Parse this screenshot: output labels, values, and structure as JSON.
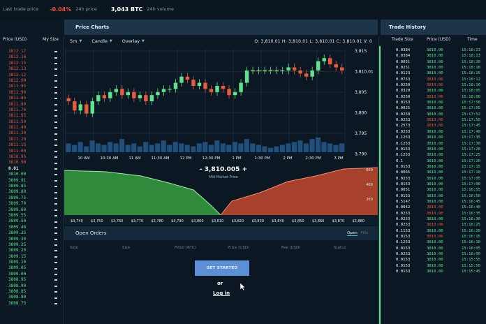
{
  "topbar": {
    "last_trade_label": "Last trade price",
    "last_trade_change": "-0.04%",
    "change_label": "24h price",
    "volume_value": "3,043 BTC",
    "volume_label": "24h volume"
  },
  "order_book": {
    "col_price": "Price (USD)",
    "col_size": "My Size",
    "asks": [
      "3812.17",
      "3812.16",
      "3812.15",
      "3812.13",
      "3812.12",
      "3812.00",
      "3811.95",
      "3811.90",
      "3811.85",
      "3811.80",
      "3811.74",
      "3811.65",
      "3811.50",
      "3811.40",
      "3811.30",
      "3811.20",
      "3811.15",
      "3811.00",
      "3810.95",
      "3810.90"
    ],
    "mid": "0.01",
    "bids": [
      "3810.00",
      "3809.91",
      "3809.85",
      "3809.80",
      "3809.75",
      "3809.70",
      "3809.60",
      "3809.55",
      "3809.50",
      "3809.40",
      "3809.35",
      "3809.30",
      "3809.25",
      "3809.20",
      "3809.15",
      "3809.10",
      "3809.05",
      "3809.00",
      "3808.95",
      "3808.90",
      "3808.85",
      "3808.80",
      "3808.75"
    ]
  },
  "price_chart": {
    "title": "Price Charts",
    "interval": "5m",
    "chart_type": "Candle",
    "overlay": "Overlay",
    "ohlc": "O: 3,810.01   H: 3,810.01   L: 3,810.01   C: 3,810.01   V: 0",
    "y_ticks": [
      "3,815",
      "3,810.01",
      "3,805",
      "3,800",
      "3,795",
      "3,790"
    ],
    "x_ticks": [
      "10 AM",
      "10:30 AM",
      "11 AM",
      "11:30 AM",
      "12 PM",
      "12:30 PM",
      "1 PM",
      "1:30 PM",
      "2 PM",
      "2:30 PM",
      "3 PM"
    ],
    "current_price_label": "3,810.01"
  },
  "depth_chart": {
    "mid_value": "3,810.005",
    "mid_label": "Mid Market Price",
    "minus": "-",
    "plus": "+",
    "x_ticks": [
      "$3,740",
      "$3,750",
      "$3,760",
      "$3,770",
      "$3,780",
      "$3,790",
      "$3,800",
      "$3,810",
      "$3,820",
      "$3,830",
      "$3,840",
      "$3,850",
      "$3,860",
      "$3,870",
      "$3,880"
    ],
    "y_ticks": [
      "600",
      "400",
      "200"
    ]
  },
  "open_orders": {
    "title": "Open Orders",
    "tab_open": "Open",
    "tab_fills": "Fills",
    "columns": [
      "Side",
      "Size",
      "Filled (BTC)",
      "Price (USD)",
      "Fee (USD)",
      "Status"
    ]
  },
  "cta": {
    "get_started": "GET STARTED",
    "or": "or",
    "login": "Log in"
  },
  "trade_history": {
    "title": "Trade History",
    "col_size": "Trade Size",
    "col_price": "Price (USD)",
    "col_time": "Time",
    "rows": [
      {
        "size": "0.0384",
        "price": "3810.00",
        "side": "buy",
        "time": "15:18:23"
      },
      {
        "size": "0.0384",
        "price": "3810.00",
        "side": "buy",
        "time": "15:18:23"
      },
      {
        "size": "0.0051",
        "price": "3810.00",
        "side": "buy",
        "time": "15:18:20"
      },
      {
        "size": "0.0251",
        "price": "3810.00",
        "side": "buy",
        "time": "15:18:18"
      },
      {
        "size": "0.0123",
        "price": "3810.00",
        "side": "buy",
        "time": "15:18:15"
      },
      {
        "size": "0.0753",
        "price": "3810.00",
        "side": "sell",
        "time": "15:18:12"
      },
      {
        "size": "0.0250",
        "price": "3810.00",
        "side": "sell",
        "time": "15:18:10"
      },
      {
        "size": "0.0320",
        "price": "3810.00",
        "side": "buy",
        "time": "15:18:05"
      },
      {
        "size": "0.0250",
        "price": "3810.00",
        "side": "sell",
        "time": "15:18:00"
      },
      {
        "size": "0.0153",
        "price": "3810.00",
        "side": "buy",
        "time": "15:17:58"
      },
      {
        "size": "0.0025",
        "price": "3810.00",
        "side": "buy",
        "time": "15:17:55"
      },
      {
        "size": "0.0250",
        "price": "3810.00",
        "side": "buy",
        "time": "15:17:52"
      },
      {
        "size": "0.0253",
        "price": "3810.00",
        "side": "sell",
        "time": "15:17:50"
      },
      {
        "size": "0.2573",
        "price": "3810.00",
        "side": "sell",
        "time": "15:17:45"
      },
      {
        "size": "0.0253",
        "price": "3810.00",
        "side": "buy",
        "time": "15:17:40"
      },
      {
        "size": "0.1253",
        "price": "3810.00",
        "side": "buy",
        "time": "15:17:35"
      },
      {
        "size": "0.1253",
        "price": "3810.00",
        "side": "buy",
        "time": "15:17:30"
      },
      {
        "size": "0.0153",
        "price": "3810.00",
        "side": "buy",
        "time": "15:17:28"
      },
      {
        "size": "0.1253",
        "price": "3810.00",
        "side": "buy",
        "time": "15:17:25"
      },
      {
        "size": "0.1",
        "price": "3810.00",
        "side": "buy",
        "time": "15:17:20"
      },
      {
        "size": "0.0153",
        "price": "3810.00",
        "side": "buy",
        "time": "15:17:15"
      },
      {
        "size": "0.0065",
        "price": "3810.00",
        "side": "buy",
        "time": "15:17:10"
      },
      {
        "size": "0.0253",
        "price": "3810.00",
        "side": "buy",
        "time": "15:17:05"
      },
      {
        "size": "0.0153",
        "price": "3810.00",
        "side": "buy",
        "time": "15:17:00"
      },
      {
        "size": "0.0051",
        "price": "3810.00",
        "side": "buy",
        "time": "15:16:55"
      },
      {
        "size": "0.0153",
        "price": "3810.00",
        "side": "buy",
        "time": "15:16:50"
      },
      {
        "size": "0.5147",
        "price": "3810.00",
        "side": "buy",
        "time": "15:16:45"
      },
      {
        "size": "0.0042",
        "price": "3810.00",
        "side": "sell",
        "time": "15:16:40"
      },
      {
        "size": "0.0253",
        "price": "3810.00",
        "side": "sell",
        "time": "15:16:35"
      },
      {
        "size": "0.0253",
        "price": "3810.00",
        "side": "buy",
        "time": "15:16:30"
      },
      {
        "size": "0.0253",
        "price": "3810.00",
        "side": "sell",
        "time": "15:16:25"
      },
      {
        "size": "0.1153",
        "price": "3810.00",
        "side": "buy",
        "time": "15:16:20"
      },
      {
        "size": "0.0153",
        "price": "3810.00",
        "side": "sell",
        "time": "15:16:15"
      },
      {
        "size": "0.1253",
        "price": "3810.00",
        "side": "buy",
        "time": "15:16:10"
      },
      {
        "size": "0.0153",
        "price": "3810.00",
        "side": "buy",
        "time": "15:16:05"
      },
      {
        "size": "0.0253",
        "price": "3810.00",
        "side": "buy",
        "time": "15:16:00"
      },
      {
        "size": "0.0153",
        "price": "3810.00",
        "side": "buy",
        "time": "15:15:55"
      },
      {
        "size": "0.0153",
        "price": "3810.00",
        "side": "buy",
        "time": "15:15:50"
      },
      {
        "size": "0.0153",
        "price": "3810.00",
        "side": "buy",
        "time": "15:15:45"
      }
    ]
  },
  "colors": {
    "up": "#5fe28a",
    "down": "#e75a3c",
    "accent": "#5b8fd6",
    "depth_bid": "#2f8a3c",
    "depth_ask": "#a8412b"
  },
  "chart_data": {
    "type": "candlestick",
    "x": [
      "10 AM",
      "10:30 AM",
      "11 AM",
      "11:30 AM",
      "12 PM",
      "12:30 PM",
      "1 PM",
      "1:30 PM",
      "2 PM",
      "2:30 PM",
      "3 PM"
    ],
    "ylim": [
      3788,
      3817
    ],
    "candles_close": [
      3800,
      3797,
      3799,
      3796,
      3800,
      3802,
      3801,
      3803,
      3804,
      3802,
      3803,
      3801,
      3802,
      3800,
      3802,
      3803,
      3804,
      3804,
      3806,
      3808,
      3807,
      3805,
      3806,
      3804,
      3803,
      3805,
      3804,
      3802,
      3803,
      3806,
      3810,
      3810,
      3810,
      3810,
      3810,
      3810,
      3810,
      3811,
      3810,
      3809,
      3808,
      3810,
      3813,
      3814,
      3812,
      3811,
      3810
    ],
    "volume": [
      6,
      5,
      7,
      4,
      8,
      6,
      5,
      7,
      6,
      9,
      5,
      6,
      4,
      7,
      5,
      6,
      8,
      5,
      7,
      6,
      5,
      4,
      6,
      7,
      5,
      8,
      6,
      5,
      7,
      6,
      9,
      6,
      5,
      4,
      3,
      4,
      5,
      6,
      7,
      8,
      6,
      9,
      10,
      7,
      6,
      5,
      6
    ]
  }
}
